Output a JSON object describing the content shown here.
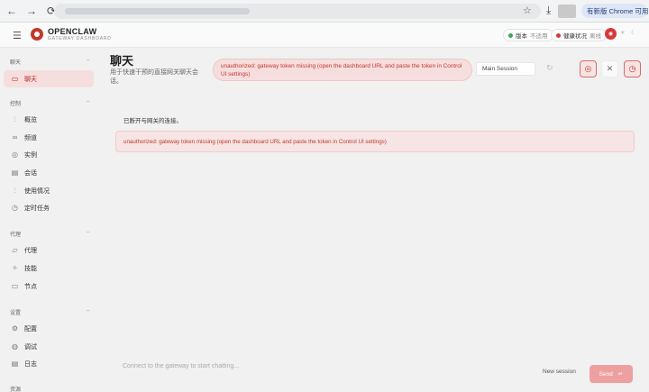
{
  "browser": {
    "back": "←",
    "forward": "→",
    "reload": "C",
    "star": "☆",
    "download": "⤓",
    "update_label": "有新版 Chrome 可用"
  },
  "header": {
    "brand": "OPENCLAW",
    "brand_sub": "GATEWAY DASHBOARD",
    "version_label": "版本",
    "version_value": "不适用",
    "health_label": "健康状况",
    "health_value": "离线",
    "accent": "#c0392b",
    "ok_color": "#3aa757"
  },
  "sidebar": {
    "groups": [
      {
        "label": "聊天"
      },
      {
        "label": "控制"
      },
      {
        "label": "代理"
      },
      {
        "label": "设置"
      },
      {
        "label": "资源"
      }
    ],
    "items": [
      {
        "label": "聊天",
        "icon": "chat-icon"
      },
      {
        "label": "概览",
        "icon": "bar-chart-icon"
      },
      {
        "label": "频道",
        "icon": "link-icon"
      },
      {
        "label": "实例",
        "icon": "broadcast-icon"
      },
      {
        "label": "会话",
        "icon": "document-icon"
      },
      {
        "label": "使用情况",
        "icon": "bar-chart-icon"
      },
      {
        "label": "定时任务",
        "icon": "clock-icon"
      },
      {
        "label": "代理",
        "icon": "folder-icon"
      },
      {
        "label": "技能",
        "icon": "sparkle-icon"
      },
      {
        "label": "节点",
        "icon": "monitor-icon"
      },
      {
        "label": "配置",
        "icon": "gear-icon"
      },
      {
        "label": "调试",
        "icon": "bug-icon"
      },
      {
        "label": "日志",
        "icon": "log-icon"
      }
    ]
  },
  "main": {
    "title": "聊天",
    "subtitle": "用于快速干预的直接网关聊天会话。",
    "error_pill": "unauthorized: gateway token missing (open the dashboard URL and paste the token in Control UI settings)",
    "session_select": "Main Session",
    "system_message": "已断开与网关的连接。",
    "error_message": "unauthorized: gateway token missing (open the dashboard URL and paste the token in Control UI settings)",
    "compose_placeholder": "Connect to the gateway to start chatting...",
    "new_session": "New session",
    "send": "Send",
    "send_icon": "↵"
  }
}
